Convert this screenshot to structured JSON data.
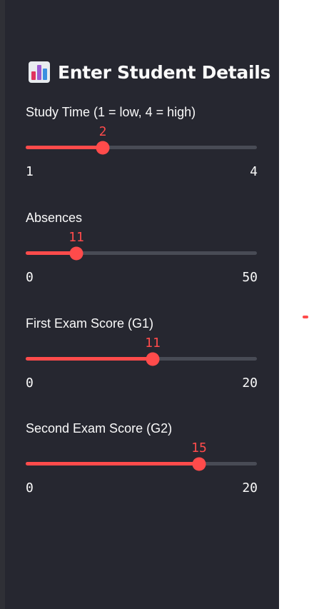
{
  "sidebar": {
    "icon": "bar-chart-icon",
    "title": "Enter Student Details",
    "sliders": [
      {
        "label": "Study Time (1 = low, 4 = high)",
        "value": 2,
        "min": 1,
        "max": 4,
        "min_label": "1",
        "max_label": "4",
        "value_label": "2"
      },
      {
        "label": "Absences",
        "value": 11,
        "min": 0,
        "max": 50,
        "min_label": "0",
        "max_label": "50",
        "value_label": "11"
      },
      {
        "label": "First Exam Score (G1)",
        "value": 11,
        "min": 0,
        "max": 20,
        "min_label": "0",
        "max_label": "20",
        "value_label": "11"
      },
      {
        "label": "Second Exam Score (G2)",
        "value": 15,
        "min": 0,
        "max": 20,
        "min_label": "0",
        "max_label": "20",
        "value_label": "15"
      }
    ]
  },
  "colors": {
    "sidebar_bg": "#262730",
    "accent": "#ff4b4b",
    "track": "#484b55",
    "text": "#fafafa"
  }
}
